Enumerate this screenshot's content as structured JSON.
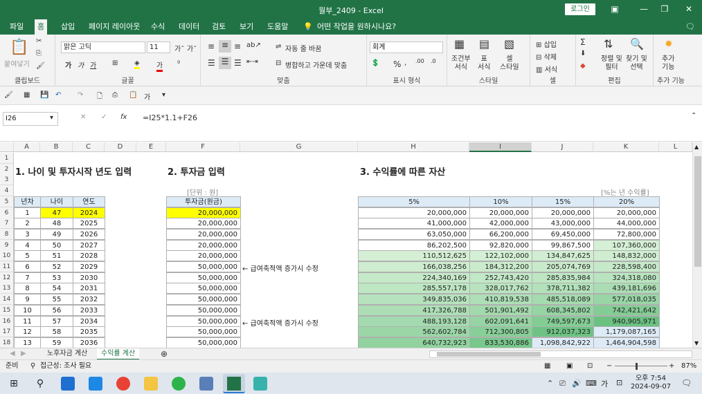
{
  "window": {
    "title": "월부_2409  -  Excel",
    "login": "로그인"
  },
  "tabs": [
    "파일",
    "홈",
    "삽입",
    "페이지 레이아웃",
    "수식",
    "데이터",
    "검토",
    "보기",
    "도움말"
  ],
  "tell_me": "어떤 작업을 원하시나요?",
  "ribbon": {
    "paste": "붙여넣기",
    "clipboard": "클립보드",
    "font_name": "맑은 고딕",
    "font_size": "11",
    "bold": "가",
    "italic": "가",
    "underline": "가",
    "font_group": "글꼴",
    "wrap": "자동 줄 바꿈",
    "merge": "병합하고 가운데 맞춤",
    "align_group": "맞춤",
    "number_format": "회계",
    "percent": "%",
    "number_group": "표시 형식",
    "cond_format": "조건부\n서식",
    "table_format": "표\n서식",
    "cell_style": "셀\n스타일",
    "style_group": "스타일",
    "insert": "삽입",
    "delete": "삭제",
    "format": "서식",
    "cells_group": "셀",
    "sort_filter": "정렬 및\n필터",
    "find_select": "찾기 및\n선택",
    "edit_group": "편집",
    "addins": "추가\n기능",
    "addins_group": "추가 기능"
  },
  "formula_bar": {
    "name_box": "I26",
    "fx": "fx",
    "formula": "=I25*1.1+F26"
  },
  "columns": [
    "A",
    "B",
    "C",
    "D",
    "E",
    "F",
    "G",
    "H",
    "I",
    "J",
    "K",
    "L"
  ],
  "rows": [
    "1",
    "2",
    "3",
    "4",
    "5",
    "6",
    "7",
    "8",
    "9",
    "10",
    "11",
    "12",
    "13",
    "14",
    "15",
    "16",
    "17",
    "18"
  ],
  "headings": {
    "s1": "1. 나이 및 투자시작 년도 입력",
    "s2": "2. 투자금 입력",
    "s3": "3. 수익률에 따른 자산",
    "unit_note": "[단위 : 원]",
    "rate_note": "[%는 년 수익률]"
  },
  "table1": {
    "headers": [
      "년차",
      "나이",
      "연도"
    ],
    "rows": [
      [
        "1",
        "47",
        "2024"
      ],
      [
        "2",
        "48",
        "2025"
      ],
      [
        "3",
        "49",
        "2026"
      ],
      [
        "4",
        "50",
        "2027"
      ],
      [
        "5",
        "51",
        "2028"
      ],
      [
        "6",
        "52",
        "2029"
      ],
      [
        "7",
        "53",
        "2030"
      ],
      [
        "8",
        "54",
        "2031"
      ],
      [
        "9",
        "55",
        "2032"
      ],
      [
        "10",
        "56",
        "2033"
      ],
      [
        "11",
        "57",
        "2034"
      ],
      [
        "12",
        "58",
        "2035"
      ],
      [
        "13",
        "59",
        "2036"
      ]
    ]
  },
  "table2": {
    "header": "투자금(원금)",
    "values": [
      "20,000,000",
      "20,000,000",
      "20,000,000",
      "20,000,000",
      "20,000,000",
      "50,000,000",
      "50,000,000",
      "50,000,000",
      "50,000,000",
      "50,000,000",
      "50,000,000",
      "50,000,000",
      "50,000,000"
    ],
    "annotations": [
      "← 급여축적액 증가시 수정",
      "← 급여축적액 증가시 수정"
    ]
  },
  "table3": {
    "headers": [
      "5%",
      "10%",
      "15%",
      "20%"
    ],
    "rows": [
      [
        "20,000,000",
        "20,000,000",
        "20,000,000",
        "20,000,000"
      ],
      [
        "41,000,000",
        "42,000,000",
        "43,000,000",
        "44,000,000"
      ],
      [
        "63,050,000",
        "66,200,000",
        "69,450,000",
        "72,800,000"
      ],
      [
        "86,202,500",
        "92,820,000",
        "99,867,500",
        "107,360,000"
      ],
      [
        "110,512,625",
        "122,102,000",
        "134,847,625",
        "148,832,000"
      ],
      [
        "166,038,256",
        "184,312,200",
        "205,074,769",
        "228,598,400"
      ],
      [
        "224,340,169",
        "252,743,420",
        "285,835,984",
        "324,318,080"
      ],
      [
        "285,557,178",
        "328,017,762",
        "378,711,382",
        "439,181,696"
      ],
      [
        "349,835,036",
        "410,819,538",
        "485,518,089",
        "577,018,035"
      ],
      [
        "417,326,788",
        "501,901,492",
        "608,345,802",
        "742,421,642"
      ],
      [
        "488,193,128",
        "602,091,641",
        "749,597,673",
        "940,905,971"
      ],
      [
        "562,602,784",
        "712,300,805",
        "912,037,323",
        "1,179,087,165"
      ],
      [
        "640,732,923",
        "833,530,886",
        "1,098,842,922",
        "1,464,904,598"
      ]
    ]
  },
  "sheet_tabs": [
    "노후자금 계산",
    "수익률 계산"
  ],
  "status": {
    "ready": "준비",
    "accessibility": "접근성: 조사 필요",
    "zoom": "87%"
  },
  "taskbar": {
    "time": "오후 7:54",
    "date": "2024-09-07",
    "ime": "가"
  },
  "colors": {
    "excel_green": "#217346",
    "header_fill": "#ddebf7",
    "input_fill": "#ffff00"
  }
}
